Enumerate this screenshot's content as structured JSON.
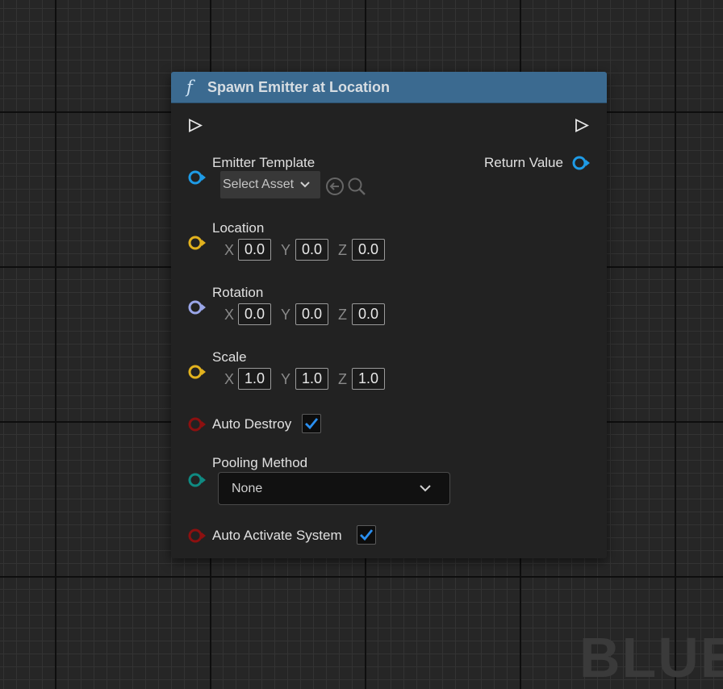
{
  "node": {
    "title": "Spawn Emitter at Location",
    "header_color": "#3b6a90",
    "function_icon": "f"
  },
  "pins": {
    "exec_in": {
      "icon": "exec-in-icon"
    },
    "exec_out": {
      "icon": "exec-out-icon"
    },
    "emitter_template": {
      "label": "Emitter Template",
      "color": "#1e9be6",
      "asset_picker_label": "Select Asset"
    },
    "return_value": {
      "label": "Return Value",
      "color": "#1e9be6"
    },
    "location": {
      "label": "Location",
      "color": "#e2b21e",
      "x_label": "X",
      "y_label": "Y",
      "z_label": "Z",
      "x": "0.0",
      "y": "0.0",
      "z": "0.0"
    },
    "rotation": {
      "label": "Rotation",
      "color": "#9aa6e8",
      "x_label": "X",
      "y_label": "Y",
      "z_label": "Z",
      "x": "0.0",
      "y": "0.0",
      "z": "0.0"
    },
    "scale": {
      "label": "Scale",
      "color": "#e2b21e",
      "x_label": "X",
      "y_label": "Y",
      "z_label": "Z",
      "x": "1.0",
      "y": "1.0",
      "z": "1.0"
    },
    "auto_destroy": {
      "label": "Auto Destroy",
      "color": "#8c1010",
      "checked": true
    },
    "pooling_method": {
      "label": "Pooling Method",
      "color": "#0f8a82",
      "selected": "None"
    },
    "auto_activate_system": {
      "label": "Auto Activate System",
      "color": "#8c1010",
      "checked": true
    }
  },
  "colors": {
    "checkmark": "#2a8ff0",
    "exec_pin": "#e6e6e6"
  }
}
